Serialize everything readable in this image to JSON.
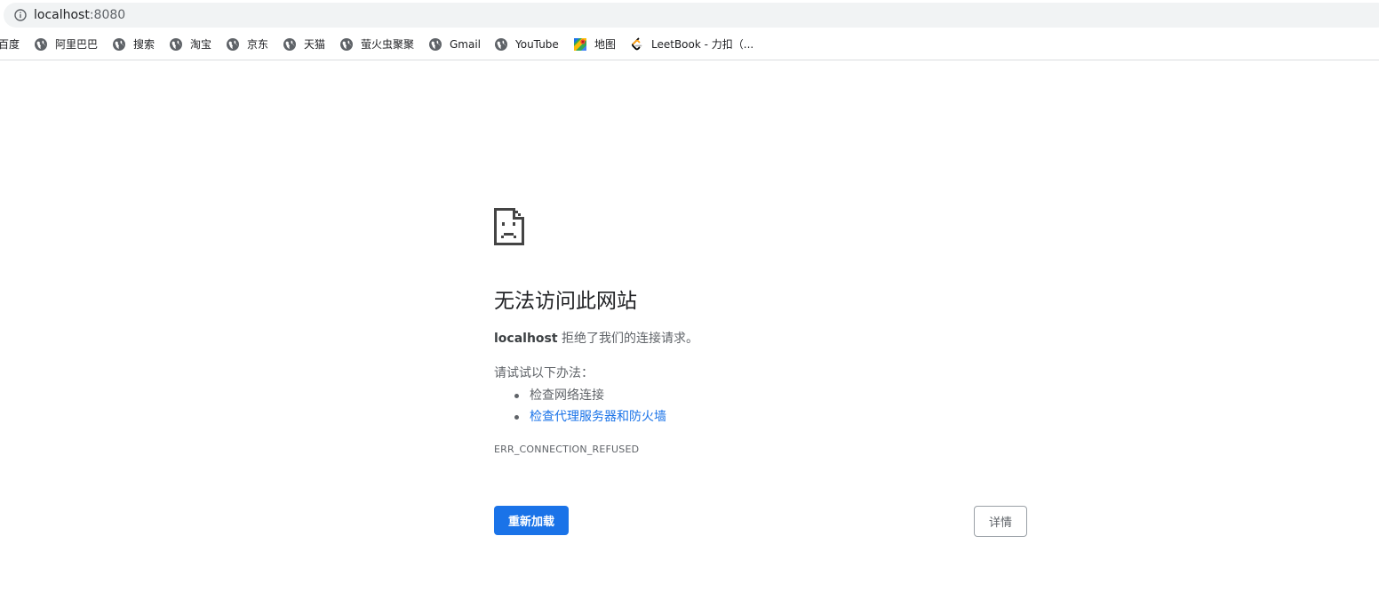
{
  "address_bar": {
    "host": "localhost",
    "port": ":8080",
    "icon": "info-icon"
  },
  "bookmarks": [
    {
      "label": "百度",
      "icon": "globe-icon"
    },
    {
      "label": "阿里巴巴",
      "icon": "globe-icon"
    },
    {
      "label": "搜索",
      "icon": "globe-icon"
    },
    {
      "label": "淘宝",
      "icon": "globe-icon"
    },
    {
      "label": "京东",
      "icon": "globe-icon"
    },
    {
      "label": "天猫",
      "icon": "globe-icon"
    },
    {
      "label": "萤火虫聚聚",
      "icon": "globe-icon"
    },
    {
      "label": "Gmail",
      "icon": "globe-icon"
    },
    {
      "label": "YouTube",
      "icon": "globe-icon"
    },
    {
      "label": "地图",
      "icon": "maps-icon"
    },
    {
      "label": "LeetBook - 力扣（...",
      "icon": "leetcode-icon"
    }
  ],
  "error_page": {
    "icon": "sad-page-icon",
    "heading": "无法访问此网站",
    "summary_host": "localhost",
    "summary_text": " 拒绝了我们的连接请求。",
    "try_label": "请试试以下办法：",
    "suggestions": [
      {
        "label": "检查网络连接",
        "link": false
      },
      {
        "label": "检查代理服务器和防火墙",
        "link": true
      }
    ],
    "error_code": "ERR_CONNECTION_REFUSED",
    "reload_label": "重新加载",
    "details_label": "详情"
  },
  "colors": {
    "accent": "#1a73e8",
    "text_primary": "#202124",
    "text_secondary": "#5f6368",
    "omnibox_bg": "#f1f3f4"
  }
}
